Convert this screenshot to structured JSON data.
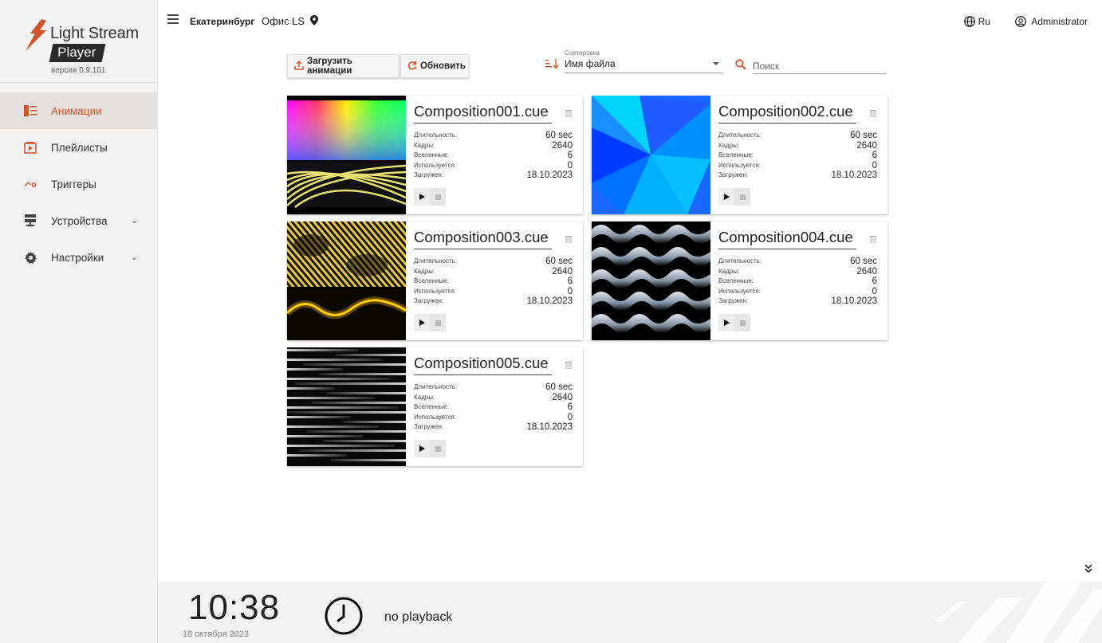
{
  "brand": {
    "name": "Light Stream",
    "product": "Player",
    "version": "версия 0.9.101",
    "accent": "#d4532a"
  },
  "nav": {
    "items": [
      {
        "label": "Анимации",
        "icon": "animations-icon",
        "active": true
      },
      {
        "label": "Плейлисты",
        "icon": "playlist-icon"
      },
      {
        "label": "Триггеры",
        "icon": "trigger-icon"
      },
      {
        "label": "Устройства",
        "icon": "devices-icon",
        "expandable": true
      },
      {
        "label": "Настройки",
        "icon": "gear-icon",
        "expandable": true
      }
    ]
  },
  "header": {
    "city": "Екатеринбург",
    "office": "Офис LS",
    "language": "Ru",
    "user": "Administrator"
  },
  "toolbar": {
    "upload_label": "Загрузить анимации",
    "refresh_label": "Обновить",
    "sort_label": "Сортировка",
    "sort_value": "Имя файла",
    "search_placeholder": "Поиск"
  },
  "labels": {
    "duration": "Длительность:",
    "frames": "Кадры:",
    "universes": "Вселенные:",
    "used": "Используется:",
    "uploaded": "Загружен:"
  },
  "animations": [
    {
      "name": "Composition001.cue",
      "duration": "60 sec",
      "frames": "2640",
      "universes": "6",
      "used": "0",
      "uploaded": "18.10.2023",
      "thumb": "rainbow-stripes"
    },
    {
      "name": "Composition002.cue",
      "duration": "60 sec",
      "frames": "2640",
      "universes": "6",
      "used": "0",
      "uploaded": "18.10.2023",
      "thumb": "blue-pinwheel"
    },
    {
      "name": "Composition003.cue",
      "duration": "60 sec",
      "frames": "2640",
      "universes": "6",
      "used": "0",
      "uploaded": "18.10.2023",
      "thumb": "yellow-wave"
    },
    {
      "name": "Composition004.cue",
      "duration": "60 sec",
      "frames": "2640",
      "universes": "6",
      "used": "0",
      "uploaded": "18.10.2023",
      "thumb": "grey-waves"
    },
    {
      "name": "Composition005.cue",
      "duration": "60 sec",
      "frames": "2640",
      "universes": "6",
      "used": "0",
      "uploaded": "18.10.2023",
      "thumb": "grey-lines"
    }
  ],
  "footer": {
    "time": "10:38",
    "date": "18 октября 2023",
    "playback_status": "no playback"
  }
}
